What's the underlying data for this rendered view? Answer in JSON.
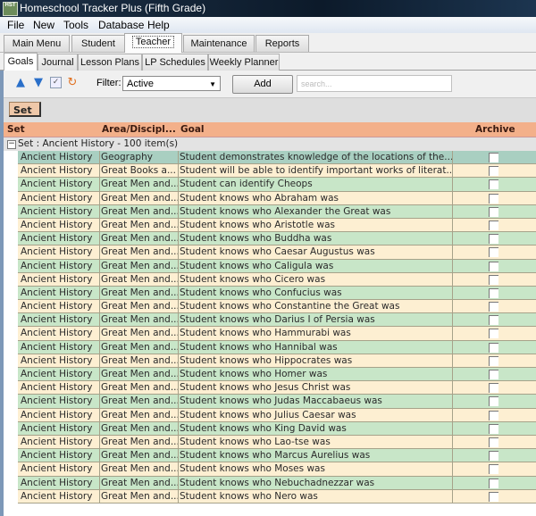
{
  "window": {
    "title": "Homeschool Tracker Plus (Fifth Grade)",
    "app_icon": "HST"
  },
  "menu": [
    "File",
    "New",
    "Tools",
    "Database",
    "Help"
  ],
  "main_tabs": [
    {
      "label": "Main Menu",
      "active": false
    },
    {
      "label": "Student",
      "active": false
    },
    {
      "label": "Teacher",
      "active": true
    },
    {
      "label": "Maintenance",
      "active": false
    },
    {
      "label": "Reports",
      "active": false
    }
  ],
  "sub_tabs": [
    {
      "label": "Goals",
      "active": true
    },
    {
      "label": "Journal",
      "active": false
    },
    {
      "label": "Lesson Plans",
      "active": false
    },
    {
      "label": "LP Schedules",
      "active": false
    },
    {
      "label": "Weekly Planner",
      "active": false
    }
  ],
  "toolbar": {
    "icons": [
      "collapse-all-icon",
      "expand-all-icon",
      "checklist-icon",
      "refresh-icon"
    ],
    "filter_label": "Filter:",
    "filter_value": "Active",
    "add_label": "Add",
    "search_placeholder": "search..."
  },
  "group_by_chip": "Set",
  "grid": {
    "columns": [
      "Set",
      "Area/Discipl...",
      "Goal",
      "Archive"
    ],
    "group_label": "Set : Ancient History - 100 item(s)",
    "rows": [
      {
        "set": "Ancient History",
        "area": "Geography",
        "goal": "Student demonstrates knowledge of the locations of the...",
        "archived": false,
        "selected": true
      },
      {
        "set": "Ancient History",
        "area": "Great Books a...",
        "goal": "Student will be able to identify important works of literat...",
        "archived": false
      },
      {
        "set": "Ancient History",
        "area": "Great Men and...",
        "goal": "Student can identify Cheops",
        "archived": false
      },
      {
        "set": "Ancient History",
        "area": "Great Men and...",
        "goal": "Student knows who Abraham was",
        "archived": false
      },
      {
        "set": "Ancient History",
        "area": "Great Men and...",
        "goal": "Student knows who Alexander the Great was",
        "archived": false
      },
      {
        "set": "Ancient History",
        "area": "Great Men and...",
        "goal": "Student knows who Aristotle was",
        "archived": false
      },
      {
        "set": "Ancient History",
        "area": "Great Men and...",
        "goal": "Student knows who Buddha was",
        "archived": false
      },
      {
        "set": "Ancient History",
        "area": "Great Men and...",
        "goal": "Student knows who Caesar Augustus was",
        "archived": false
      },
      {
        "set": "Ancient History",
        "area": "Great Men and...",
        "goal": "Student knows who Caligula was",
        "archived": false
      },
      {
        "set": "Ancient History",
        "area": "Great Men and...",
        "goal": "Student knows who Cicero was",
        "archived": false
      },
      {
        "set": "Ancient History",
        "area": "Great Men and...",
        "goal": "Student knows who Confucius was",
        "archived": false
      },
      {
        "set": "Ancient History",
        "area": "Great Men and...",
        "goal": "Student knows who Constantine the Great was",
        "archived": false
      },
      {
        "set": "Ancient History",
        "area": "Great Men and...",
        "goal": "Student knows who Darius I of Persia was",
        "archived": false
      },
      {
        "set": "Ancient History",
        "area": "Great Men and...",
        "goal": "Student knows who Hammurabi was",
        "archived": false
      },
      {
        "set": "Ancient History",
        "area": "Great Men and...",
        "goal": "Student knows who Hannibal was",
        "archived": false
      },
      {
        "set": "Ancient History",
        "area": "Great Men and...",
        "goal": "Student knows who Hippocrates was",
        "archived": false
      },
      {
        "set": "Ancient History",
        "area": "Great Men and...",
        "goal": "Student knows who Homer was",
        "archived": false
      },
      {
        "set": "Ancient History",
        "area": "Great Men and...",
        "goal": "Student knows who Jesus Christ was",
        "archived": false
      },
      {
        "set": "Ancient History",
        "area": "Great Men and...",
        "goal": "Student knows who Judas Maccabaeus was",
        "archived": false
      },
      {
        "set": "Ancient History",
        "area": "Great Men and...",
        "goal": "Student knows who Julius Caesar was",
        "archived": false
      },
      {
        "set": "Ancient History",
        "area": "Great Men and...",
        "goal": "Student knows who King David was",
        "archived": false
      },
      {
        "set": "Ancient History",
        "area": "Great Men and...",
        "goal": "Student knows who Lao-tse was",
        "archived": false
      },
      {
        "set": "Ancient History",
        "area": "Great Men and...",
        "goal": "Student knows who Marcus Aurelius was",
        "archived": false
      },
      {
        "set": "Ancient History",
        "area": "Great Men and...",
        "goal": "Student knows who Moses was",
        "archived": false
      },
      {
        "set": "Ancient History",
        "area": "Great Men and...",
        "goal": "Student knows who Nebuchadnezzar was",
        "archived": false
      },
      {
        "set": "Ancient History",
        "area": "Great Men and...",
        "goal": "Student knows who Nero was",
        "archived": false
      }
    ]
  },
  "colors": {
    "header": "#f3b08a",
    "row_green": "#c8e6c8",
    "row_cream": "#fdefd2",
    "row_selected": "#a9cfc1"
  }
}
